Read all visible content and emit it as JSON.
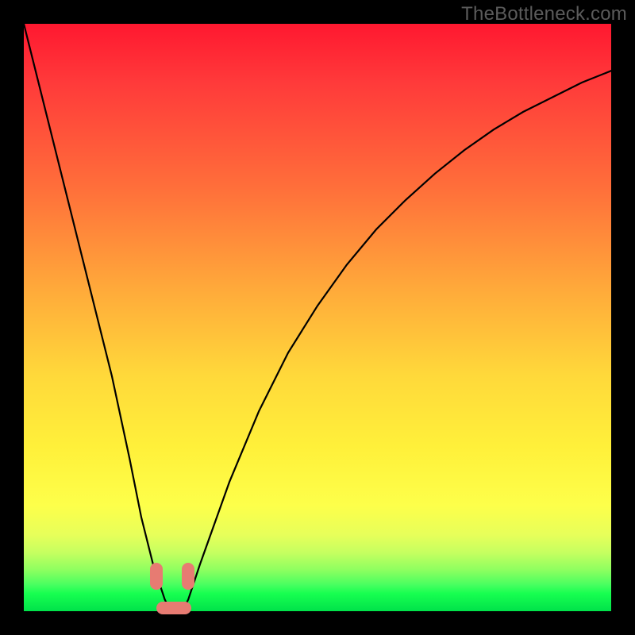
{
  "watermark": "TheBottleneck.com",
  "colors": {
    "background": "#000000",
    "watermark_text": "#5b5b5b",
    "curve_stroke": "#000000",
    "marker_fill": "#e77b72",
    "gradient_top": "#ff1830",
    "gradient_bottom": "#00e24a"
  },
  "chart_data": {
    "type": "line",
    "title": "",
    "xlabel": "",
    "ylabel": "",
    "xlim": [
      0,
      100
    ],
    "ylim": [
      0,
      100
    ],
    "series": [
      {
        "name": "bottleneck-curve",
        "x": [
          0,
          5,
          10,
          15,
          18,
          20,
          22,
          24,
          25,
          26,
          27,
          28,
          29,
          30,
          35,
          40,
          45,
          50,
          55,
          60,
          65,
          70,
          75,
          80,
          85,
          90,
          95,
          100
        ],
        "values": [
          100,
          80,
          60,
          40,
          26,
          16,
          8,
          2,
          0,
          0,
          0,
          2,
          5,
          8,
          22,
          34,
          44,
          52,
          59,
          65,
          70,
          74.5,
          78.5,
          82,
          85,
          87.5,
          90,
          92
        ]
      }
    ],
    "annotations": [
      {
        "name": "left-arm-marker",
        "x": 22.5,
        "y": 6,
        "shape": "pill-vertical"
      },
      {
        "name": "right-arm-marker",
        "x": 28.0,
        "y": 6,
        "shape": "pill-vertical"
      },
      {
        "name": "basin-marker",
        "x": 25.5,
        "y": 0.5,
        "shape": "pill-horizontal"
      }
    ]
  }
}
